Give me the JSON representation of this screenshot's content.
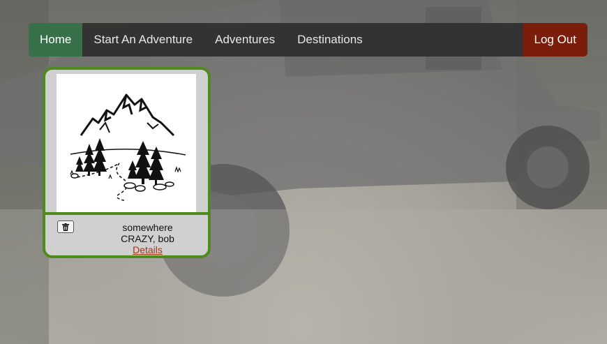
{
  "nav": {
    "home": "Home",
    "start_adventure": "Start An Adventure",
    "adventures": "Adventures",
    "destinations": "Destinations",
    "logout": "Log Out"
  },
  "card": {
    "image_icon": "mountain-trees-landscape-icon",
    "location": "somewhere",
    "author": "CRAZY, bob",
    "details_link": "Details",
    "delete_icon": "trash-icon"
  },
  "colors": {
    "navbar": "#333333",
    "active_tab": "#38704a",
    "logout": "#7a1e0b",
    "card_border": "#4e8a1f",
    "details_link": "#a3331c"
  }
}
